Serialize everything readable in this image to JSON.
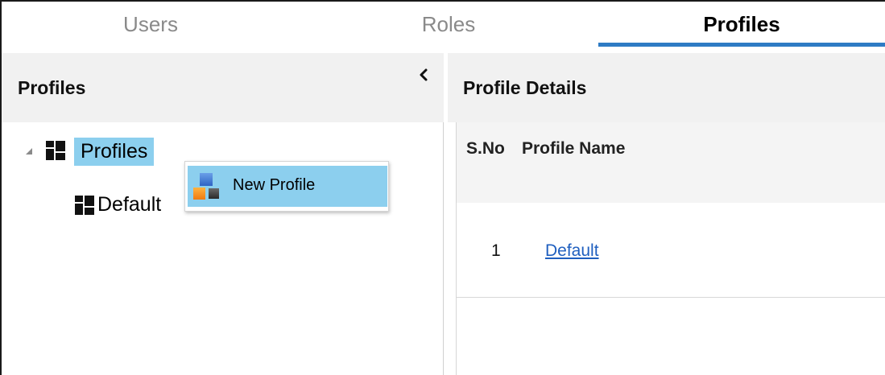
{
  "tabs": [
    {
      "label": "Users",
      "active": false
    },
    {
      "label": "Roles",
      "active": false
    },
    {
      "label": "Profiles",
      "active": true
    }
  ],
  "left_panel": {
    "title": "Profiles",
    "collapse_icon": "chevron-left-icon",
    "tree": {
      "root_label": "Profiles",
      "root_icon": "profile-grid-icon",
      "expanded": true,
      "children": [
        {
          "label": "Default",
          "icon": "profile-grid-icon"
        }
      ]
    }
  },
  "context_menu": {
    "items": [
      {
        "label": "New Profile",
        "icon": "new-profile-icon"
      }
    ]
  },
  "right_panel": {
    "title": "Profile Details",
    "columns": [
      "S.No",
      "Profile Name"
    ],
    "rows": [
      {
        "sno": "1",
        "name": "Default"
      }
    ]
  },
  "colors": {
    "accent": "#2e7bc4",
    "selection": "#8ccfee",
    "header_bg": "#f1f1f1",
    "link": "#1f5fbf"
  }
}
